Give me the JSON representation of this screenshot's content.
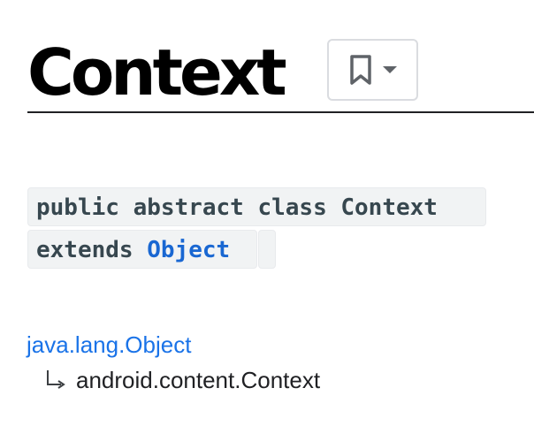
{
  "page": {
    "title": "Context"
  },
  "bookmark_control": {
    "icon": "bookmark-icon",
    "dropdown_icon": "caret-down-icon"
  },
  "class_signature": {
    "declaration": "public abstract class Context",
    "extends_keyword": "extends ",
    "superclass": "Object"
  },
  "inheritance": {
    "root": "java.lang.Object",
    "child_icon": "subclass-arrow-icon",
    "child": "android.content.Context"
  },
  "colors": {
    "link": "#1a73e8",
    "code_background": "#f1f3f4",
    "code_text": "#37474f",
    "title": "#000000"
  }
}
